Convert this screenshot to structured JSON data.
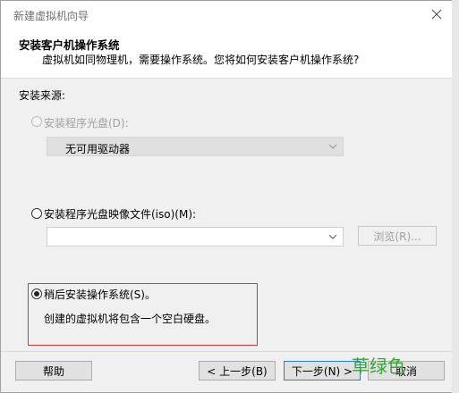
{
  "window": {
    "title": "新建虚拟机向导",
    "header_title": "安装客户机操作系统",
    "header_desc": "虚拟机如同物理机，需要操作系统。您将如何安装客户机操作系统?"
  },
  "install_source": {
    "label": "安装来源:",
    "option_disc": "安装程序光盘(D):",
    "disc_combo_value": "无可用驱动器",
    "option_iso": "安装程序光盘映像文件(iso)(M):",
    "iso_combo_value": "",
    "browse_button": "浏览(R)...",
    "option_later": "稍后安装操作系统(S)。",
    "later_desc": "创建的虚拟机将包含一个空白硬盘。"
  },
  "footer": {
    "help_button": "帮助",
    "back_button": "< 上一步(B)",
    "next_button": "下一步(N) >",
    "cancel_button": "取消",
    "watermark": "草绿色"
  },
  "state": {
    "selected_option": "later"
  },
  "colors": {
    "highlight_border": "#d23a3a",
    "watermark": "#35a535"
  }
}
